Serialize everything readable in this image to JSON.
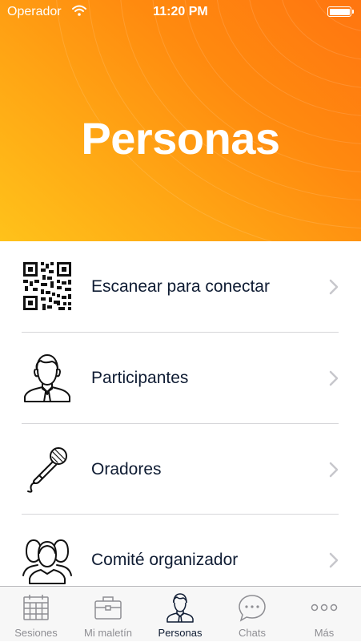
{
  "status_bar": {
    "carrier": "Operador",
    "time": "11:20 PM"
  },
  "header": {
    "title": "Personas",
    "gradient_colors": [
      "#ffc21a",
      "#ff7510"
    ]
  },
  "menu": {
    "items": [
      {
        "label": "Escanear para conectar",
        "icon": "qr-code-icon"
      },
      {
        "label": "Participantes",
        "icon": "person-icon"
      },
      {
        "label": "Oradores",
        "icon": "microphone-icon"
      },
      {
        "label": "Comité organizador",
        "icon": "group-icon"
      }
    ]
  },
  "tab_bar": {
    "active": "Personas",
    "tabs": [
      {
        "label": "Sesiones",
        "icon": "calendar-icon"
      },
      {
        "label": "Mi maletín",
        "icon": "briefcase-icon"
      },
      {
        "label": "Personas",
        "icon": "person-icon"
      },
      {
        "label": "Chats",
        "icon": "chat-bubble-icon"
      },
      {
        "label": "Más",
        "icon": "more-dots-icon"
      }
    ]
  },
  "colors": {
    "text_dark": "#0f1c33",
    "tab_inactive": "#8e8e93",
    "chevron": "#c7c7cc"
  }
}
